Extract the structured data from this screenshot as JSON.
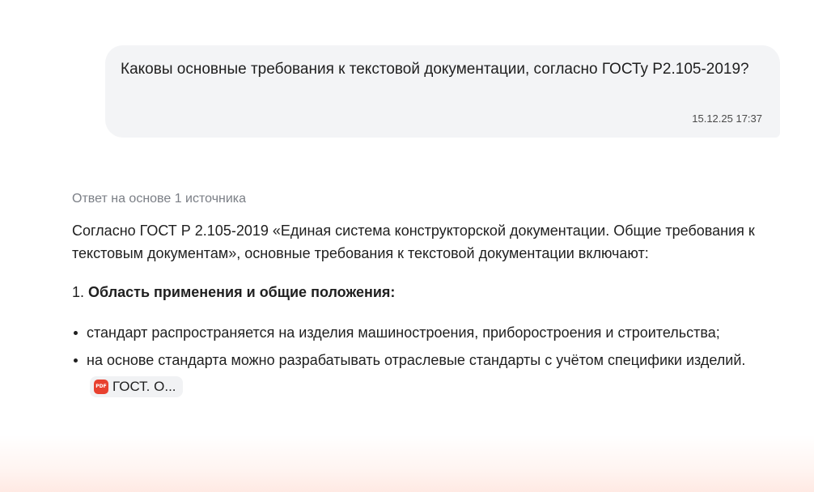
{
  "user_message": {
    "text": "Каковы основные требования к текстовой документации, согласно ГОСТу Р2.105-2019?",
    "timestamp": "15.12.25 17:37"
  },
  "answer": {
    "sources_label": "Ответ на основе 1 источника",
    "intro": "Согласно ГОСТ Р 2.105-2019 «Единая система конструкторской документации. Общие требования к текстовым документам», основные требования к текстовой документации включают:",
    "section_number": "1.",
    "section_title": "Область применения и общие положения:",
    "bullets": [
      "стандарт распространяется на изделия машиностроения, приборостроения и строительства;",
      "на основе стандарта можно разрабатывать отраслевые стандарты с учётом специфики изделий."
    ],
    "source_chip": {
      "icon": "pdf-icon",
      "icon_text": "PDF",
      "label": "ГОСТ. О..."
    }
  }
}
